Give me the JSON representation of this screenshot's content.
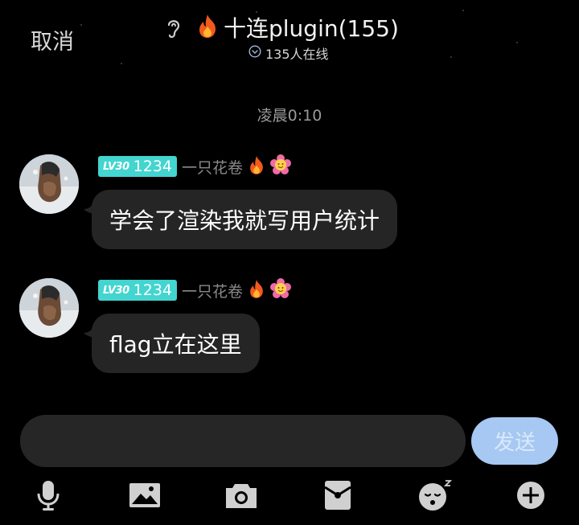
{
  "header": {
    "cancel_label": "取消",
    "title": "十连plugin(155)",
    "online_count": "135人在线",
    "icons": [
      "ear-icon",
      "fire-icon",
      "chevron-down-circle-icon"
    ]
  },
  "timestamp": "凌晨0:10",
  "messages": [
    {
      "level": "LV30",
      "level_num": "1234",
      "nickname": "一只花卷",
      "text": "学会了渲染我就写用户统计",
      "badges": [
        "fire-icon",
        "flower-emoji-icon"
      ]
    },
    {
      "level": "LV30",
      "level_num": "1234",
      "nickname": "一只花卷",
      "text": "flag立在这里",
      "badges": [
        "fire-icon",
        "flower-emoji-icon"
      ]
    }
  ],
  "composer": {
    "input_value": "",
    "send_label": "发送"
  },
  "toolbar": [
    "microphone-icon",
    "image-icon",
    "camera-icon",
    "red-packet-icon",
    "emoji-icon",
    "plus-icon"
  ],
  "colors": {
    "background": "#000000",
    "bubble": "#252525",
    "level_badge": "#43d5cf",
    "send_button": "#a6c8f2",
    "input_box": "#262626"
  }
}
